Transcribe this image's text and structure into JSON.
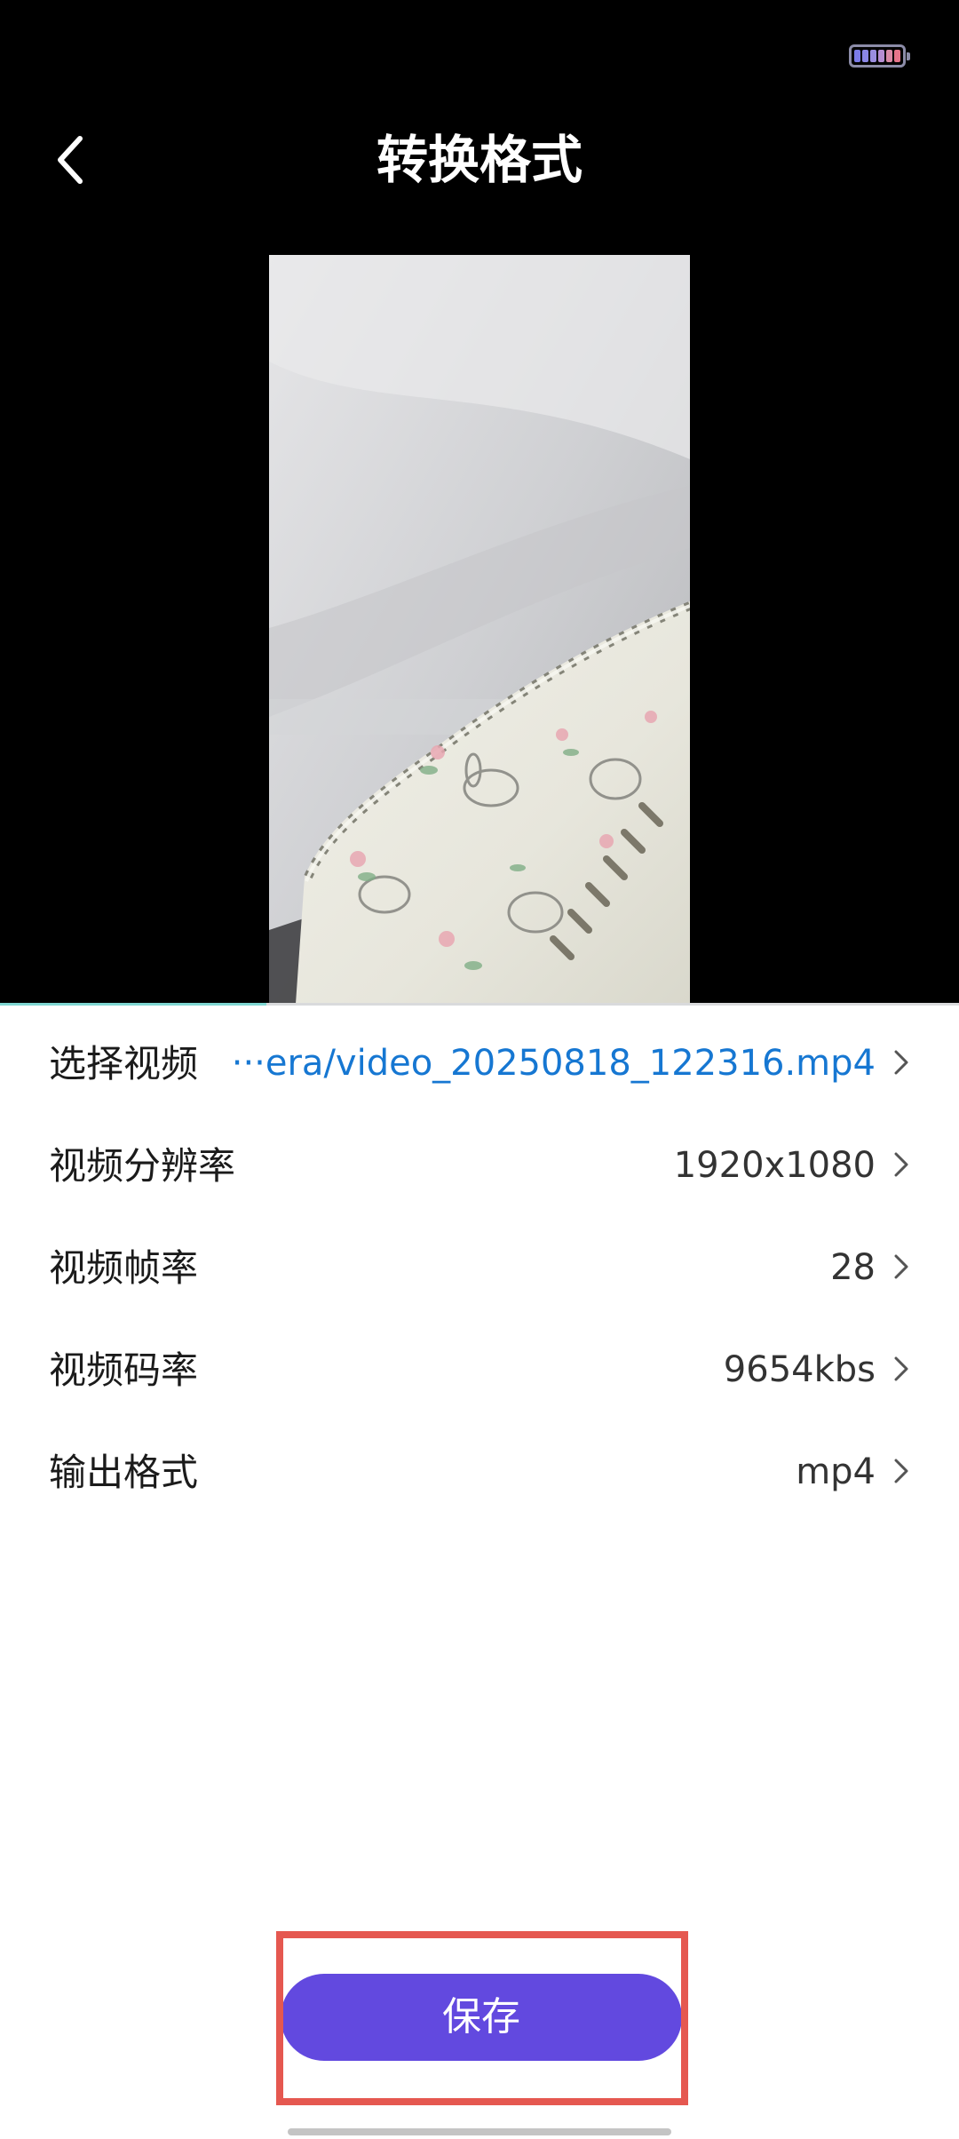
{
  "status_bar": {
    "battery_icon": "battery-icon",
    "battery_cell_colors": [
      "#7b7be8",
      "#8a86e6",
      "#9a8ddf",
      "#b58ed2",
      "#d88aa6",
      "#e6748a"
    ]
  },
  "nav": {
    "back_icon": "chevron-left-icon",
    "title": "转换格式"
  },
  "video_preview": {
    "description_icon": "video-preview"
  },
  "settings": [
    {
      "label": "选择视频",
      "value": "···era/video_20250818_122316.mp4",
      "is_link": true
    },
    {
      "label": "视频分辨率",
      "value": "1920x1080",
      "is_link": false
    },
    {
      "label": "视频帧率",
      "value": "28",
      "is_link": false
    },
    {
      "label": "视频码率",
      "value": "9654kbs",
      "is_link": false
    },
    {
      "label": "输出格式",
      "value": "mp4",
      "is_link": false
    }
  ],
  "footer": {
    "save_label": "保存"
  },
  "colors": {
    "accent": "#6249df",
    "link": "#1677d2",
    "highlight": "#e55850"
  }
}
